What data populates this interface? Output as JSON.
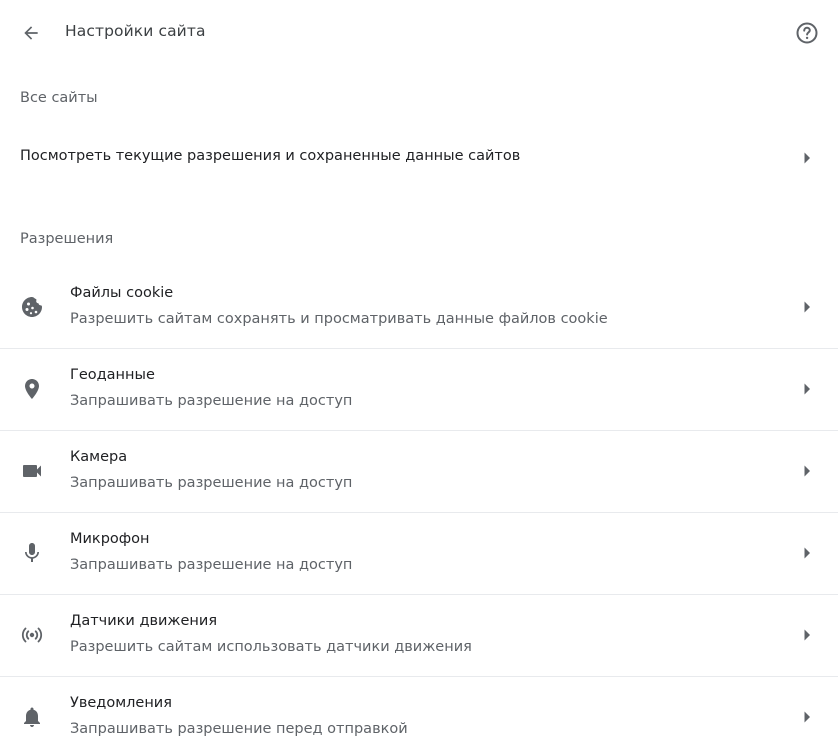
{
  "header": {
    "title": "Настройки сайта"
  },
  "all_sites": {
    "heading": "Все сайты",
    "link_label": "Посмотреть текущие разрешения и сохраненные данные сайтов"
  },
  "permissions": {
    "heading": "Разрешения",
    "items": [
      {
        "title": "Файлы cookie",
        "subtitle": "Разрешить сайтам сохранять и просматривать данные файлов cookie",
        "icon": "cookie-icon"
      },
      {
        "title": "Геоданные",
        "subtitle": "Запрашивать разрешение на доступ",
        "icon": "location-pin-icon"
      },
      {
        "title": "Камера",
        "subtitle": "Запрашивать разрешение на доступ",
        "icon": "videocam-icon"
      },
      {
        "title": "Микрофон",
        "subtitle": "Запрашивать разрешение на доступ",
        "icon": "mic-icon"
      },
      {
        "title": "Датчики движения",
        "subtitle": "Разрешить сайтам использовать датчики движения",
        "icon": "sensors-icon"
      },
      {
        "title": "Уведомления",
        "subtitle": "Запрашивать разрешение перед отправкой",
        "icon": "bell-icon"
      }
    ]
  },
  "colors": {
    "icon": "#5f6368",
    "divider": "#e8eaed",
    "primary_text": "#202124",
    "secondary_text": "#5f6368"
  }
}
